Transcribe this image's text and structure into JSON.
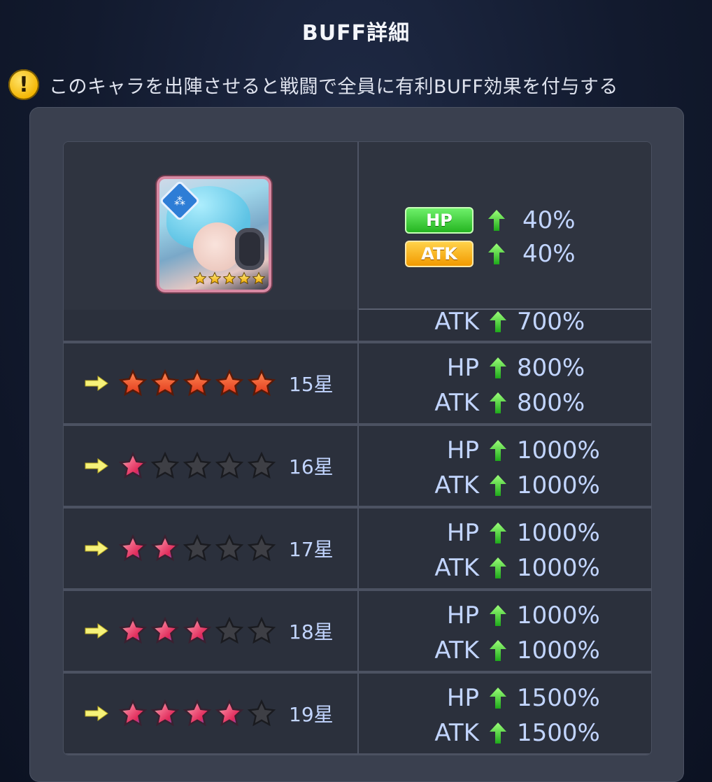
{
  "header": {
    "title": "BUFF詳細"
  },
  "notice": {
    "icon": "warning-icon",
    "icon_glyph": "!",
    "text": "このキャラを出陣させると戦闘で全員に有利BUFF効果を付与する"
  },
  "character": {
    "class_icon": "support-class-icon",
    "stars": 5
  },
  "current_buff": {
    "hp_label": "HP",
    "hp_value": "40%",
    "atk_label": "ATK",
    "atk_value": "40%"
  },
  "partial_row": {
    "atk_label": "ATK",
    "atk_value": "700%"
  },
  "rows": [
    {
      "stars": "15星",
      "star_type": [
        "orange",
        "orange",
        "orange",
        "orange",
        "orange"
      ],
      "hp_label": "HP",
      "hp": "800%",
      "atk_label": "ATK",
      "atk": "800%"
    },
    {
      "stars": "16星",
      "star_type": [
        "rainbow",
        "dark",
        "dark",
        "dark",
        "dark"
      ],
      "hp_label": "HP",
      "hp": "1000%",
      "atk_label": "ATK",
      "atk": "1000%"
    },
    {
      "stars": "17星",
      "star_type": [
        "rainbow",
        "rainbow",
        "dark",
        "dark",
        "dark"
      ],
      "hp_label": "HP",
      "hp": "1000%",
      "atk_label": "ATK",
      "atk": "1000%"
    },
    {
      "stars": "18星",
      "star_type": [
        "rainbow",
        "rainbow",
        "rainbow",
        "dark",
        "dark"
      ],
      "hp_label": "HP",
      "hp": "1000%",
      "atk_label": "ATK",
      "atk": "1000%"
    },
    {
      "stars": "19星",
      "star_type": [
        "rainbow",
        "rainbow",
        "rainbow",
        "rainbow",
        "dark"
      ],
      "hp_label": "HP",
      "hp": "1500%",
      "atk_label": "ATK",
      "atk": "1500%"
    }
  ],
  "colors": {
    "accent_blue": "#c2d5ff",
    "hp_green": "#25b521",
    "atk_orange": "#f29a00",
    "arrow_green": "#3fd93a"
  }
}
